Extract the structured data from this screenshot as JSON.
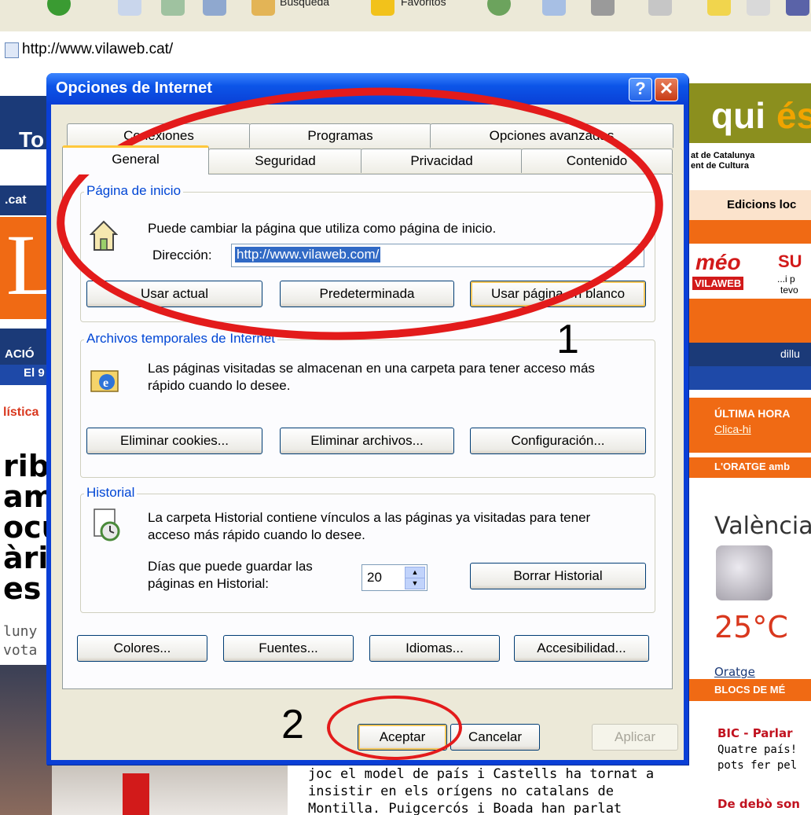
{
  "browser": {
    "toolbar_items": [
      {
        "name": "back-icon",
        "label": ""
      },
      {
        "name": "search-toolbar-icon",
        "label": "Búsqueda"
      },
      {
        "name": "favorites-star-icon",
        "label": "Favoritos"
      }
    ],
    "address_url": "http://www.vilaweb.cat/"
  },
  "page": {
    "top_left_word": "To",
    "left_nav": ".cat",
    "left_menu": "ACIÓ",
    "left_num": "El 9",
    "left_section": "lística",
    "left_headline_lines": [
      "riba",
      "ami",
      "ocu",
      "àri",
      "es "
    ],
    "left_sub_lines": [
      "luny",
      "vota"
    ],
    "logo_fragment": "L",
    "brand": {
      "qui": "qui",
      "es": "és"
    },
    "brand_sub": [
      "at de Catalunya",
      "ent de Cultura"
    ],
    "edicions": "Edicions loc",
    "promo": {
      "meo": "méo",
      "vilaweb": "VILAWEB",
      "su": "SU",
      "line2": "...i p",
      "line3": "tevo"
    },
    "dilluns": "dillu",
    "ultima_hora": "ÚLTIMA HORA",
    "clica": "Clica-hi",
    "oratge_header": "L'ORATGE amb",
    "city": "València",
    "temp": "25°C",
    "oratge_link": "Oratge",
    "blocs": "BLOCS DE MÉ",
    "bic": "BIC - Parlar",
    "bic_l1": "Quatre país!",
    "bic_l2": "pots fer pel",
    "debo": "De debò son",
    "article_lines": [
      "joc el model de país i Castells ha tornat a",
      "insistir en els orígens no catalans de",
      "Montilla. Puigcercós i Boada han parlat"
    ]
  },
  "dialog": {
    "title": "Opciones de Internet",
    "help": "?",
    "close": "✕",
    "tabs_back": [
      "Conexiones",
      "Programas",
      "Opciones avanzadas"
    ],
    "tabs_front": [
      "General",
      "Seguridad",
      "Privacidad",
      "Contenido"
    ],
    "home": {
      "legend": "Página de inicio",
      "desc": "Puede cambiar la página que utiliza como página de inicio.",
      "address_label": "Dirección:",
      "address_value": "http://www.vilaweb.com/",
      "btn_current": "Usar actual",
      "btn_default": "Predeterminada",
      "btn_blank": "Usar página en blanco"
    },
    "temp": {
      "legend": "Archivos temporales de Internet",
      "desc_l1": "Las páginas visitadas se almacenan en una carpeta para tener acceso más",
      "desc_l2": "rápido cuando lo desee.",
      "btn_cookies": "Eliminar cookies...",
      "btn_files": "Eliminar archivos...",
      "btn_config": "Configuración..."
    },
    "history": {
      "legend": "Historial",
      "desc_l1": "La carpeta Historial contiene vínculos a las páginas ya visitadas para tener",
      "desc_l2": "acceso más rápido cuando lo desee.",
      "days_l1": "Días que puede guardar las",
      "days_l2": "páginas en Historial:",
      "days_value": "20",
      "btn_clear": "Borrar Historial"
    },
    "bottom_buttons": [
      "Colores...",
      "Fuentes...",
      "Idiomas...",
      "Accesibilidad..."
    ],
    "ok": "Aceptar",
    "cancel": "Cancelar",
    "apply": "Aplicar"
  },
  "annotations": {
    "step1": "1",
    "step2": "2",
    "color": "#e31b1b"
  }
}
